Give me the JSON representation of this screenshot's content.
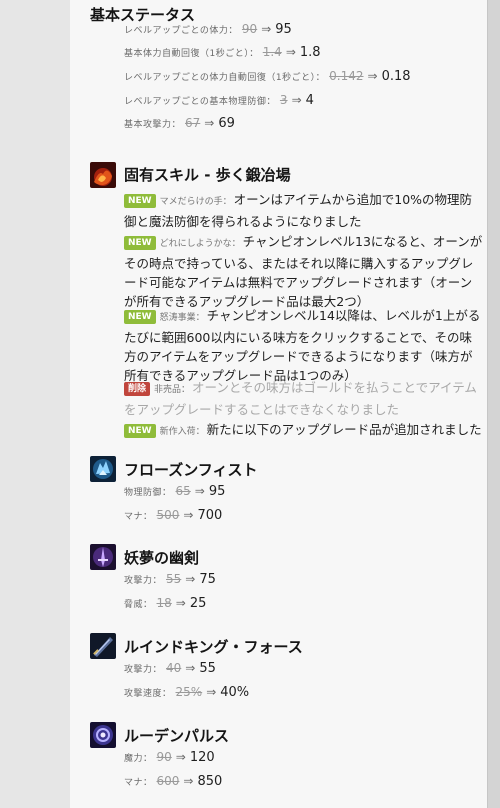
{
  "base_stats": {
    "title": "基本ステータス",
    "rows": [
      {
        "label": "レベルアップごとの体力：",
        "old": "90",
        "new": "95"
      },
      {
        "label": "基本体力自動回復（1秒ごと）：",
        "old": "1.4",
        "new": "1.8"
      },
      {
        "label": "レベルアップごとの体力自動回復（1秒ごと）：",
        "old": "0.142",
        "new": "0.18"
      },
      {
        "label": "レベルアップごとの基本物理防御：",
        "old": "3",
        "new": "4"
      },
      {
        "label": "基本攻撃力：",
        "old": "67",
        "new": "69"
      }
    ]
  },
  "arrow": "⇒",
  "passive": {
    "title": "固有スキル - 歩く鍛冶場",
    "changes": [
      {
        "badge": "NEW",
        "name": "マメだらけの手：",
        "text": "オーンはアイテムから追加で10%の物理防御と魔法防御を得られるようになりました"
      },
      {
        "badge": "NEW",
        "name": "どれにしようかな：",
        "text": "チャンピオンレベル13になると、オーンがその時点で持っている、またはそれ以降に購入するアップグレード可能なアイテムは無料でアップグレードされます（オーンが所有できるアップグレード品は最大2つ）"
      },
      {
        "badge": "NEW",
        "name": "怒涛事業：",
        "text": "チャンピオンレベル14以降は、レベルが1上がるたびに範囲600以内にいる味方をクリックすることで、その味方のアイテムをアップグレードできるようになります（味方が所有できるアップグレード品は1つのみ）"
      },
      {
        "badge": "削除",
        "name": "非売品：",
        "text": "オーンとその味方はゴールドを払うことでアイテムをアップグレードすることはできなくなりました"
      },
      {
        "badge": "NEW",
        "name": "新作入荷：",
        "text": "新たに以下のアップグレード品が追加されました"
      }
    ]
  },
  "items": [
    {
      "name": "フローズンフィスト",
      "icon": "frozen-fist-icon",
      "stats": [
        {
          "label": "物理防御：",
          "old": "65",
          "new": "95"
        },
        {
          "label": "マナ：",
          "old": "500",
          "new": "700"
        }
      ]
    },
    {
      "name": "妖夢の幽剣",
      "icon": "youmuu-ghostblade-icon",
      "stats": [
        {
          "label": "攻撃力：",
          "old": "55",
          "new": "75"
        },
        {
          "label": "脅威：",
          "old": "18",
          "new": "25"
        }
      ]
    },
    {
      "name": "ルインドキング・フォース",
      "icon": "ruined-king-force-icon",
      "stats": [
        {
          "label": "攻撃力：",
          "old": "40",
          "new": "55"
        },
        {
          "label": "攻撃速度：",
          "old": "25%",
          "new": "40%"
        }
      ]
    },
    {
      "name": "ルーデンパルス",
      "icon": "luden-pulse-icon",
      "stats": [
        {
          "label": "魔力：",
          "old": "90",
          "new": "120"
        },
        {
          "label": "マナ：",
          "old": "600",
          "new": "850"
        }
      ]
    }
  ]
}
